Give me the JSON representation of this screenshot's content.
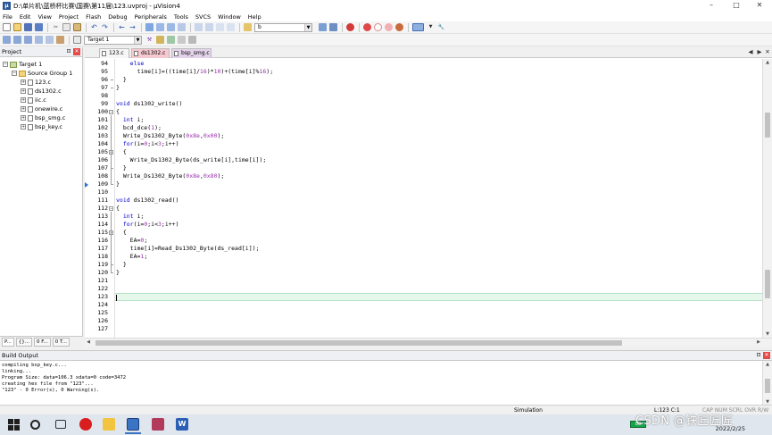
{
  "window": {
    "title": "D:\\单片机\\蓝桥杯比赛\\国赛\\第11届\\123.uvproj - µVision4",
    "min_label": "–",
    "max_label": "□",
    "close_label": "✕"
  },
  "menu": [
    "File",
    "Edit",
    "View",
    "Project",
    "Flash",
    "Debug",
    "Peripherals",
    "Tools",
    "SVCS",
    "Window",
    "Help"
  ],
  "toolbar": {
    "find_value": "b",
    "target_value": "Target 1"
  },
  "project_panel": {
    "title": "Project",
    "tree": {
      "target": "Target 1",
      "group": "Source Group 1",
      "files": [
        "123.c",
        "ds1302.c",
        "iic.c",
        "onewire.c",
        "bsp_smg.c",
        "bsp_key.c"
      ]
    },
    "tabs": [
      "P...",
      "{}...",
      "0 F...",
      "0 T..."
    ]
  },
  "editor": {
    "tabs": [
      "123.c",
      "ds1302.c",
      "bsp_smg.c"
    ],
    "active_tab": 1,
    "current_line": 123,
    "breakpoint_line": 109,
    "code_lines": [
      {
        "n": "94",
        "segs": [
          [
            "kw",
            "    else"
          ]
        ]
      },
      {
        "n": "95",
        "segs": [
          [
            "",
            "      time[i]=((time[i]/"
          ],
          [
            "num",
            "16"
          ],
          [
            "",
            ")*"
          ],
          [
            "num",
            "10"
          ],
          [
            "",
            ")+(time[i]%"
          ],
          [
            "num",
            "16"
          ],
          [
            "",
            ");"
          ]
        ]
      },
      {
        "n": "96",
        "segs": [
          [
            "",
            "  }"
          ]
        ]
      },
      {
        "n": "97",
        "segs": [
          [
            "",
            "}"
          ]
        ]
      },
      {
        "n": "98",
        "segs": [
          [
            "",
            ""
          ]
        ]
      },
      {
        "n": "99",
        "segs": [
          [
            "kw",
            "void"
          ],
          [
            "",
            " ds1302_write()"
          ]
        ]
      },
      {
        "n": "100",
        "segs": [
          [
            "",
            "{"
          ]
        ]
      },
      {
        "n": "101",
        "segs": [
          [
            "kw",
            "  int"
          ],
          [
            "",
            " i;"
          ]
        ]
      },
      {
        "n": "102",
        "segs": [
          [
            "",
            "  bcd_dce("
          ],
          [
            "num",
            "1"
          ],
          [
            "",
            ");"
          ]
        ]
      },
      {
        "n": "103",
        "segs": [
          [
            "",
            "  Write_Ds1302_Byte("
          ],
          [
            "num",
            "0x8e"
          ],
          [
            "",
            ","
          ],
          [
            "num",
            "0x00"
          ],
          [
            "",
            ");"
          ]
        ]
      },
      {
        "n": "104",
        "segs": [
          [
            "kw",
            "  for"
          ],
          [
            "",
            "(i="
          ],
          [
            "num",
            "0"
          ],
          [
            "",
            ";i<"
          ],
          [
            "num",
            "3"
          ],
          [
            "",
            ";i++)"
          ]
        ]
      },
      {
        "n": "105",
        "segs": [
          [
            "",
            "  {"
          ]
        ]
      },
      {
        "n": "106",
        "segs": [
          [
            "",
            "    Write_Ds1302_Byte(ds_write[i],time[i]);"
          ]
        ]
      },
      {
        "n": "107",
        "segs": [
          [
            "",
            "  }"
          ]
        ]
      },
      {
        "n": "108",
        "segs": [
          [
            "",
            "  Write_Ds1302_Byte("
          ],
          [
            "num",
            "0x8e"
          ],
          [
            "",
            ","
          ],
          [
            "num",
            "0x80"
          ],
          [
            "",
            ");"
          ]
        ]
      },
      {
        "n": "109",
        "segs": [
          [
            "",
            "}"
          ]
        ]
      },
      {
        "n": "110",
        "segs": [
          [
            "",
            ""
          ]
        ]
      },
      {
        "n": "111",
        "segs": [
          [
            "kw",
            "void"
          ],
          [
            "",
            " ds1302_read()"
          ]
        ]
      },
      {
        "n": "112",
        "segs": [
          [
            "",
            "{"
          ]
        ]
      },
      {
        "n": "113",
        "segs": [
          [
            "kw",
            "  int"
          ],
          [
            "",
            " i;"
          ]
        ]
      },
      {
        "n": "114",
        "segs": [
          [
            "kw",
            "  for"
          ],
          [
            "",
            "(i="
          ],
          [
            "num",
            "0"
          ],
          [
            "",
            ";i<"
          ],
          [
            "num",
            "3"
          ],
          [
            "",
            ";i++)"
          ]
        ]
      },
      {
        "n": "115",
        "segs": [
          [
            "",
            "  {"
          ]
        ]
      },
      {
        "n": "116",
        "segs": [
          [
            "",
            "    EA="
          ],
          [
            "num",
            "0"
          ],
          [
            "",
            ";"
          ]
        ]
      },
      {
        "n": "117",
        "segs": [
          [
            "",
            "    time[i]=Read_Ds1302_Byte(ds_read[i]);"
          ]
        ]
      },
      {
        "n": "118",
        "segs": [
          [
            "",
            "    EA="
          ],
          [
            "num",
            "1"
          ],
          [
            "",
            ";"
          ]
        ]
      },
      {
        "n": "119",
        "segs": [
          [
            "",
            "  }"
          ]
        ]
      },
      {
        "n": "120",
        "segs": [
          [
            "",
            "}"
          ]
        ]
      },
      {
        "n": "121",
        "segs": [
          [
            "",
            ""
          ]
        ]
      },
      {
        "n": "122",
        "segs": [
          [
            "",
            ""
          ]
        ]
      },
      {
        "n": "123",
        "segs": [
          [
            "",
            ""
          ]
        ]
      },
      {
        "n": "124",
        "segs": [
          [
            "",
            ""
          ]
        ]
      },
      {
        "n": "125",
        "segs": [
          [
            "",
            ""
          ]
        ]
      },
      {
        "n": "126",
        "segs": [
          [
            "",
            ""
          ]
        ]
      },
      {
        "n": "127",
        "segs": [
          [
            "",
            ""
          ]
        ]
      }
    ]
  },
  "build_output": {
    "title": "Build Output",
    "lines": [
      "compiling bsp_key.c...",
      "linking...",
      "Program Size: data=106.3 xdata=0 code=3472",
      "creating hex file from \"123\"...",
      "\"123\" - 0 Error(s), 0 Warning(s)."
    ]
  },
  "status": {
    "mode": "Simulation",
    "position": "L:123 C:1",
    "indicators": "CAP  NUM  SCRL  OVR  R/W"
  },
  "taskbar": {
    "battery": "80",
    "date": "2022/2/25"
  },
  "watermark": "CSDN @铁匠匠匠",
  "colors": {
    "keyword": "#0000d0",
    "number": "#9b2fae",
    "current_line": "#e6f7ec",
    "active_tab": "#f6c8cf"
  }
}
